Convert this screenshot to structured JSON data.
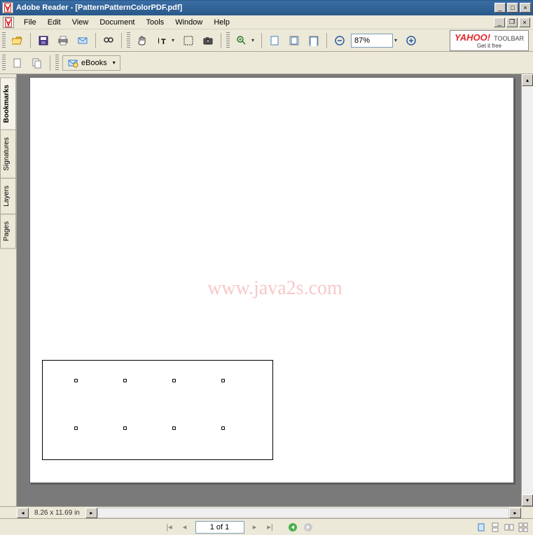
{
  "titlebar": {
    "app": "Adobe Reader",
    "doc": "[PatternPatternColorPDF.pdf]"
  },
  "menu": {
    "file": "File",
    "edit": "Edit",
    "view": "View",
    "document": "Document",
    "tools": "Tools",
    "window": "Window",
    "help": "Help"
  },
  "toolbar": {
    "zoom_value": "87%",
    "yahoo_logo": "YAHOO!",
    "yahoo_label": "TOOLBAR",
    "yahoo_sub": "Get it free",
    "ebooks_label": "eBooks"
  },
  "navtabs": {
    "bookmarks": "Bookmarks",
    "signatures": "Signatures",
    "layers": "Layers",
    "pages": "Pages"
  },
  "watermark": "www.java2s.com",
  "hscroll": {
    "page_size": "8.26 x 11.69 in"
  },
  "statusbar": {
    "page_field": "1 of 1"
  }
}
